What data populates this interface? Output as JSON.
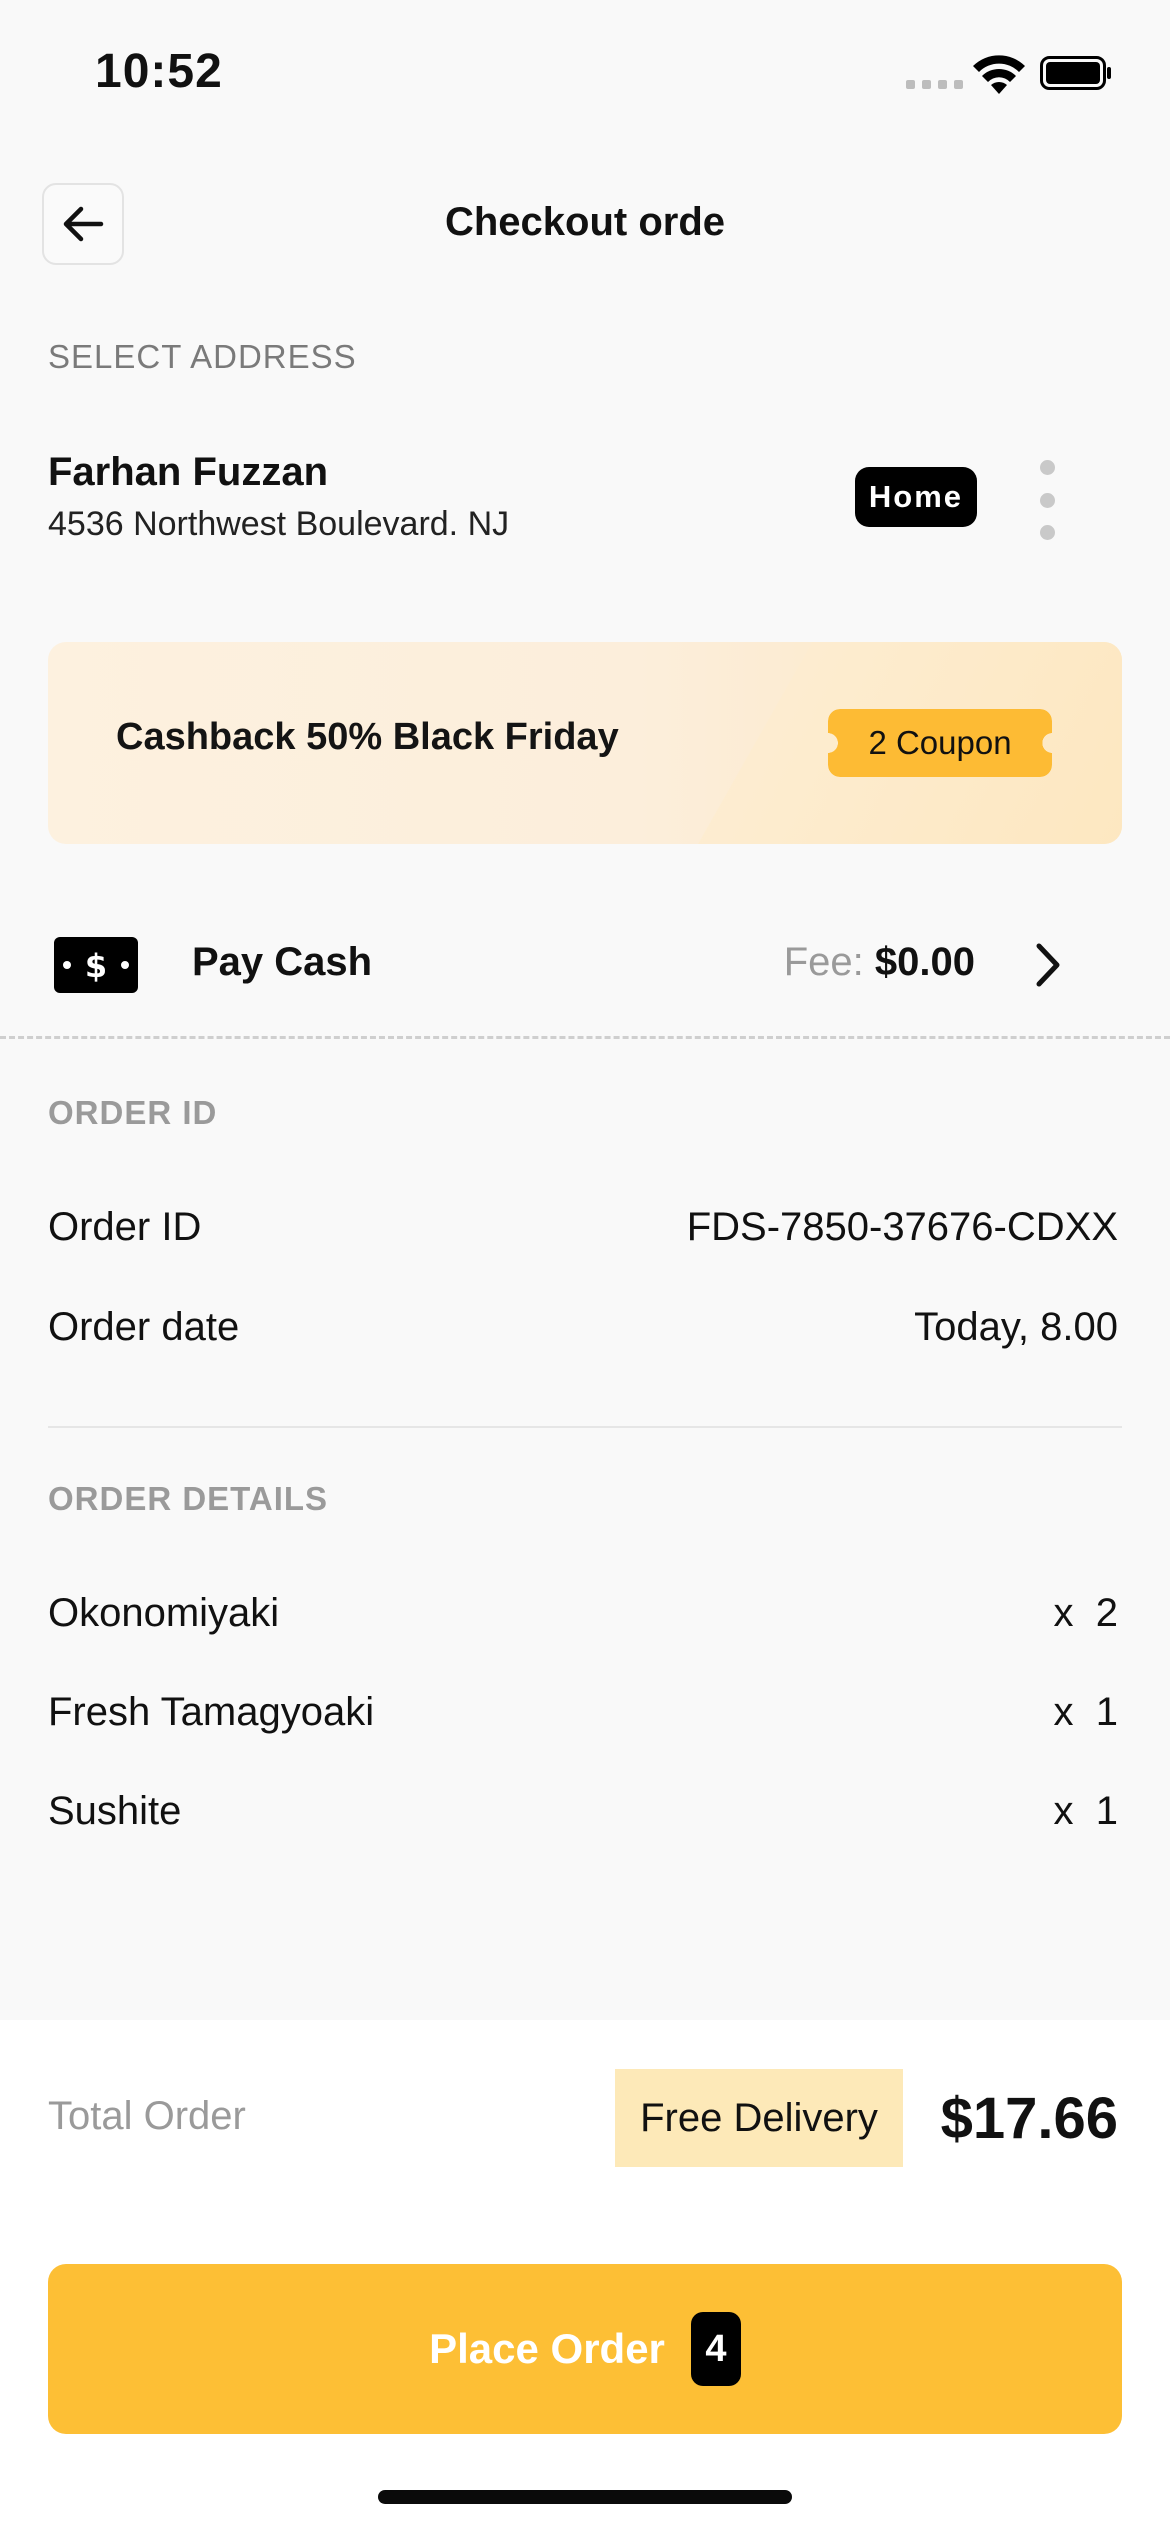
{
  "status_bar": {
    "time": "10:52"
  },
  "header": {
    "title": "Checkout orde",
    "back_icon": "arrow-left-icon"
  },
  "address": {
    "section_label": "SELECT ADDRESS",
    "name": "Farhan Fuzzan",
    "street": "4536 Northwest Boulevard. NJ",
    "tag": "Home"
  },
  "promo": {
    "text": "Cashback 50% Black Friday",
    "coupon": "2 Coupon"
  },
  "payment": {
    "method": "Pay Cash",
    "fee_label": "Fee:",
    "fee_value": "$0.00",
    "icon": "cash-icon"
  },
  "order_info": {
    "section_label": "ORDER ID",
    "rows": [
      {
        "label": "Order ID",
        "value": "FDS-7850-37676-CDXX"
      },
      {
        "label": "Order date",
        "value": "Today, 8.00"
      }
    ]
  },
  "order_details": {
    "section_label": "ORDER DETAILS",
    "items": [
      {
        "name": "Okonomiyaki",
        "qty": "x  2"
      },
      {
        "name": "Fresh Tamagyoaki",
        "qty": "x  1"
      },
      {
        "name": "Sushite",
        "qty": "x  1"
      }
    ]
  },
  "summary": {
    "total_label": "Total Order",
    "delivery_badge": "Free Delivery",
    "total_value": "$17.66"
  },
  "cta": {
    "label": "Place Order",
    "count": "4"
  },
  "colors": {
    "accent": "#fdbf35",
    "badge_bg": "#fde9b8",
    "promo_bg": "#fdf1df"
  }
}
